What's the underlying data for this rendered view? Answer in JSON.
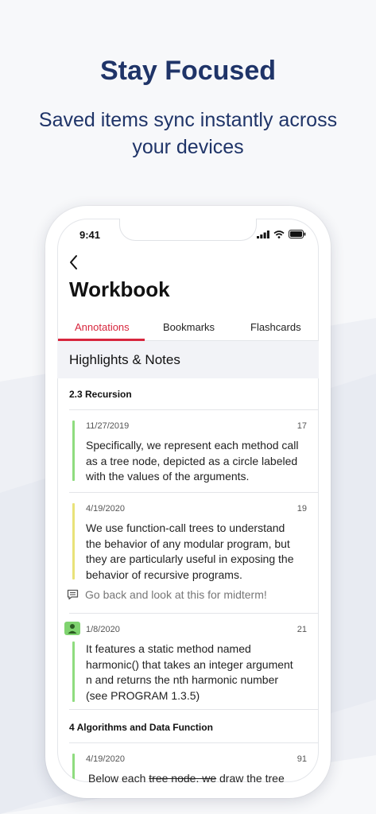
{
  "promo": {
    "headline": "Stay Focused",
    "subhead_line1": "Saved items sync instantly across",
    "subhead_line2": "your devices"
  },
  "status_bar": {
    "time": "9:41"
  },
  "screen": {
    "title": "Workbook",
    "tabs": [
      {
        "label": "Annotations",
        "active": true
      },
      {
        "label": "Bookmarks",
        "active": false
      },
      {
        "label": "Flashcards",
        "active": false
      }
    ],
    "section_title": "Highlights & Notes",
    "chapters": [
      {
        "label": "2.3 Recursion"
      },
      {
        "label": "4 Algorithms and Data Function"
      }
    ],
    "notes": [
      {
        "date": "11/27/2019",
        "page": "17",
        "highlight_color": "#8fdc7f",
        "lines": [
          "Specifically, we represent each method call",
          "as a tree node, depicted as a circle labeled",
          "with the values of the arguments."
        ]
      },
      {
        "date": "4/19/2020",
        "page": "19",
        "highlight_color": "#e9e27a",
        "lines": [
          "We use function-call trees to understand",
          "the behavior of any modular program, but",
          "they are particularly useful in exposing the",
          "behavior of recursive programs."
        ],
        "comment": "Go back and look at this for midterm!"
      },
      {
        "date": "1/8/2020",
        "page": "21",
        "highlight_color": "#8fdc7f",
        "shared": true,
        "lines": [
          "It features a static method named",
          "harmonic() that takes an integer argument",
          "n and returns the nth harmonic number",
          "(see PROGRAM 1.3.5)"
        ]
      },
      {
        "date": "4/19/2020",
        "page": "91",
        "highlight_color": "#8fdc7f",
        "text_before": "Below each ",
        "text_struck": "tree node, we",
        "text_after": " draw the tree"
      }
    ]
  },
  "colors": {
    "brand_navy": "#1f3468",
    "tab_active": "#d7263d"
  },
  "icons": [
    "back-chevron-icon",
    "signal-icon",
    "wifi-icon",
    "battery-icon",
    "comment-icon",
    "user-icon"
  ]
}
